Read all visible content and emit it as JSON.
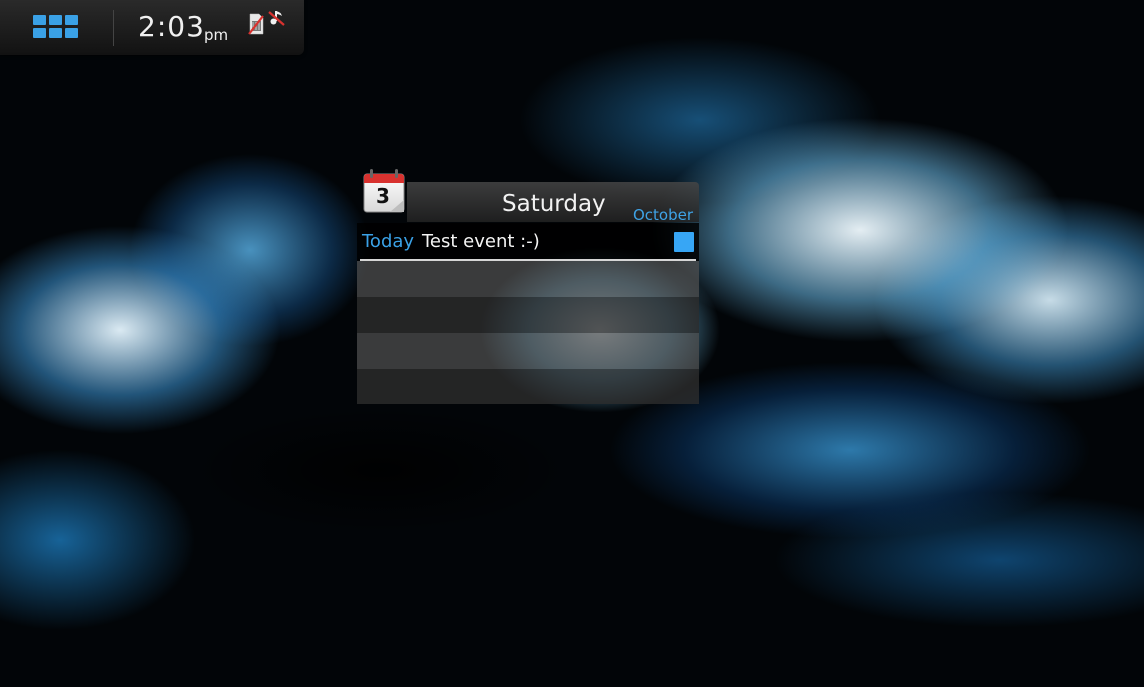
{
  "statusbar": {
    "time": "2:03",
    "ampm": "pm",
    "icons": [
      "app-grid-icon",
      "sim-disabled-icon",
      "music-muted-icon"
    ]
  },
  "calendar_widget": {
    "icon_day_number": "3",
    "day": "Saturday",
    "month": "October",
    "event": {
      "day_label": "Today",
      "title": "Test event :-)",
      "color": "#37a6f5"
    },
    "empty_rows": 4
  },
  "colors": {
    "accent": "#3aa1e6",
    "text": "#f0f0f0",
    "icon_red": "#d8322f"
  }
}
